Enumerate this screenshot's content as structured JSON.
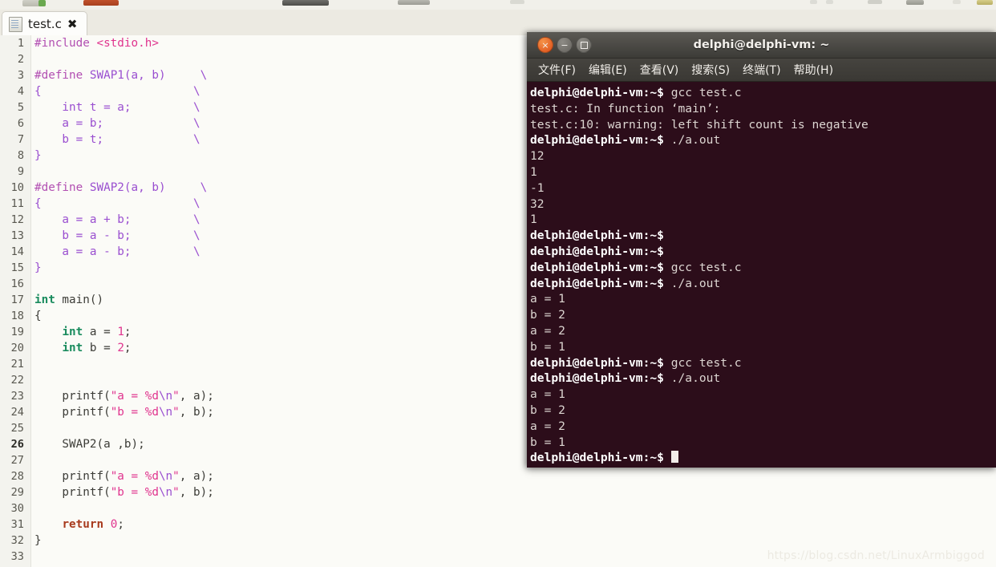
{
  "toolbar": {
    "icons": [
      "new-file-icon",
      "save-icon",
      "print-icon",
      "undo-icon",
      "redo-icon",
      "cut-icon",
      "copy-icon",
      "paste-icon",
      "find-icon",
      "replace-icon",
      "build-icon"
    ]
  },
  "tab": {
    "label": "test.c",
    "close_label": "✖",
    "icon": "c-source-file-icon"
  },
  "editor": {
    "current_line": 26,
    "colors": {
      "background": "#fbfbf7",
      "gutter": "#f3f3ee",
      "preprocessor": "#b24fb2",
      "header": "#e0348e",
      "macro_body": "#9a4fd0",
      "type_keyword": "#1a8c5e",
      "number": "#e0348e",
      "string": "#e0348e",
      "escape": "#9a4fd0",
      "return_keyword": "#a83a1e",
      "plain": "#3d3d38"
    },
    "lines": [
      {
        "n": 1,
        "tokens": [
          {
            "t": "#include ",
            "c": "k-pre"
          },
          {
            "t": "<stdio.h>",
            "c": "k-hdr"
          }
        ]
      },
      {
        "n": 2,
        "tokens": []
      },
      {
        "n": 3,
        "tokens": [
          {
            "t": "#define ",
            "c": "k-pre"
          },
          {
            "t": "SWAP1(a, b)     \\",
            "c": "k-macro"
          }
        ]
      },
      {
        "n": 4,
        "tokens": [
          {
            "t": "{                      \\",
            "c": "k-macro"
          }
        ]
      },
      {
        "n": 5,
        "tokens": [
          {
            "t": "    int t = a;         \\",
            "c": "k-macro"
          }
        ]
      },
      {
        "n": 6,
        "tokens": [
          {
            "t": "    a = b;             \\",
            "c": "k-macro"
          }
        ]
      },
      {
        "n": 7,
        "tokens": [
          {
            "t": "    b = t;             \\",
            "c": "k-macro"
          }
        ]
      },
      {
        "n": 8,
        "tokens": [
          {
            "t": "}",
            "c": "k-macro"
          }
        ]
      },
      {
        "n": 9,
        "tokens": []
      },
      {
        "n": 10,
        "tokens": [
          {
            "t": "#define ",
            "c": "k-pre"
          },
          {
            "t": "SWAP2(a, b)     \\",
            "c": "k-macro"
          }
        ]
      },
      {
        "n": 11,
        "tokens": [
          {
            "t": "{                      \\",
            "c": "k-macro"
          }
        ]
      },
      {
        "n": 12,
        "tokens": [
          {
            "t": "    a = a + b;         \\",
            "c": "k-macro"
          }
        ]
      },
      {
        "n": 13,
        "tokens": [
          {
            "t": "    b = a - b;         \\",
            "c": "k-macro"
          }
        ]
      },
      {
        "n": 14,
        "tokens": [
          {
            "t": "    a = a - b;         \\",
            "c": "k-macro"
          }
        ]
      },
      {
        "n": 15,
        "tokens": [
          {
            "t": "}",
            "c": "k-macro"
          }
        ]
      },
      {
        "n": 16,
        "tokens": []
      },
      {
        "n": 17,
        "tokens": [
          {
            "t": "int",
            "c": "k-type"
          },
          {
            "t": " main()",
            "c": "k-plain"
          }
        ]
      },
      {
        "n": 18,
        "tokens": [
          {
            "t": "{",
            "c": "k-plain"
          }
        ]
      },
      {
        "n": 19,
        "tokens": [
          {
            "t": "    ",
            "c": "k-plain"
          },
          {
            "t": "int",
            "c": "k-type"
          },
          {
            "t": " a = ",
            "c": "k-plain"
          },
          {
            "t": "1",
            "c": "k-num"
          },
          {
            "t": ";",
            "c": "k-plain"
          }
        ]
      },
      {
        "n": 20,
        "tokens": [
          {
            "t": "    ",
            "c": "k-plain"
          },
          {
            "t": "int",
            "c": "k-type"
          },
          {
            "t": " b = ",
            "c": "k-plain"
          },
          {
            "t": "2",
            "c": "k-num"
          },
          {
            "t": ";",
            "c": "k-plain"
          }
        ]
      },
      {
        "n": 21,
        "tokens": []
      },
      {
        "n": 22,
        "tokens": []
      },
      {
        "n": 23,
        "tokens": [
          {
            "t": "    printf(",
            "c": "k-plain"
          },
          {
            "t": "\"a = %d",
            "c": "k-str"
          },
          {
            "t": "\\n",
            "c": "k-esc"
          },
          {
            "t": "\"",
            "c": "k-str"
          },
          {
            "t": ", a);",
            "c": "k-plain"
          }
        ]
      },
      {
        "n": 24,
        "tokens": [
          {
            "t": "    printf(",
            "c": "k-plain"
          },
          {
            "t": "\"b = %d",
            "c": "k-str"
          },
          {
            "t": "\\n",
            "c": "k-esc"
          },
          {
            "t": "\"",
            "c": "k-str"
          },
          {
            "t": ", b);",
            "c": "k-plain"
          }
        ]
      },
      {
        "n": 25,
        "tokens": []
      },
      {
        "n": 26,
        "tokens": [
          {
            "t": "    SWAP2(a ,b);",
            "c": "k-plain"
          }
        ]
      },
      {
        "n": 27,
        "tokens": []
      },
      {
        "n": 28,
        "tokens": [
          {
            "t": "    printf(",
            "c": "k-plain"
          },
          {
            "t": "\"a = %d",
            "c": "k-str"
          },
          {
            "t": "\\n",
            "c": "k-esc"
          },
          {
            "t": "\"",
            "c": "k-str"
          },
          {
            "t": ", a);",
            "c": "k-plain"
          }
        ]
      },
      {
        "n": 29,
        "tokens": [
          {
            "t": "    printf(",
            "c": "k-plain"
          },
          {
            "t": "\"b = %d",
            "c": "k-str"
          },
          {
            "t": "\\n",
            "c": "k-esc"
          },
          {
            "t": "\"",
            "c": "k-str"
          },
          {
            "t": ", b);",
            "c": "k-plain"
          }
        ]
      },
      {
        "n": 30,
        "tokens": []
      },
      {
        "n": 31,
        "tokens": [
          {
            "t": "    ",
            "c": "k-plain"
          },
          {
            "t": "return",
            "c": "k-ret"
          },
          {
            "t": " ",
            "c": "k-plain"
          },
          {
            "t": "0",
            "c": "k-num"
          },
          {
            "t": ";",
            "c": "k-plain"
          }
        ]
      },
      {
        "n": 32,
        "tokens": [
          {
            "t": "}",
            "c": "k-plain"
          }
        ]
      },
      {
        "n": 33,
        "tokens": []
      }
    ]
  },
  "terminal": {
    "title": "delphi@delphi-vm: ~",
    "window_buttons": {
      "close": "×",
      "minimize": "−",
      "maximize": "□"
    },
    "menu": [
      "文件(F)",
      "编辑(E)",
      "查看(V)",
      "搜索(S)",
      "终端(T)",
      "帮助(H)"
    ],
    "prompt": "delphi@delphi-vm:~$",
    "colors": {
      "background": "#2c0d1a",
      "text": "#ddd6d2",
      "titlebar": "#46443f"
    },
    "lines": [
      {
        "prompt": true,
        "text": " gcc test.c"
      },
      {
        "prompt": false,
        "text": "test.c: In function ‘main’:"
      },
      {
        "prompt": false,
        "text": "test.c:10: warning: left shift count is negative"
      },
      {
        "prompt": true,
        "text": " ./a.out"
      },
      {
        "prompt": false,
        "text": "12"
      },
      {
        "prompt": false,
        "text": "1"
      },
      {
        "prompt": false,
        "text": "-1"
      },
      {
        "prompt": false,
        "text": "32"
      },
      {
        "prompt": false,
        "text": "1"
      },
      {
        "prompt": true,
        "text": ""
      },
      {
        "prompt": true,
        "text": ""
      },
      {
        "prompt": true,
        "text": " gcc test.c"
      },
      {
        "prompt": true,
        "text": " ./a.out"
      },
      {
        "prompt": false,
        "text": "a = 1"
      },
      {
        "prompt": false,
        "text": "b = 2"
      },
      {
        "prompt": false,
        "text": "a = 2"
      },
      {
        "prompt": false,
        "text": "b = 1"
      },
      {
        "prompt": true,
        "text": " gcc test.c"
      },
      {
        "prompt": true,
        "text": " ./a.out"
      },
      {
        "prompt": false,
        "text": "a = 1"
      },
      {
        "prompt": false,
        "text": "b = 2"
      },
      {
        "prompt": false,
        "text": "a = 2"
      },
      {
        "prompt": false,
        "text": "b = 1"
      },
      {
        "prompt": true,
        "text": " ",
        "cursor": true
      }
    ],
    "mouse_caret": "I"
  },
  "watermark": "https://blog.csdn.net/LinuxArmbiggod"
}
